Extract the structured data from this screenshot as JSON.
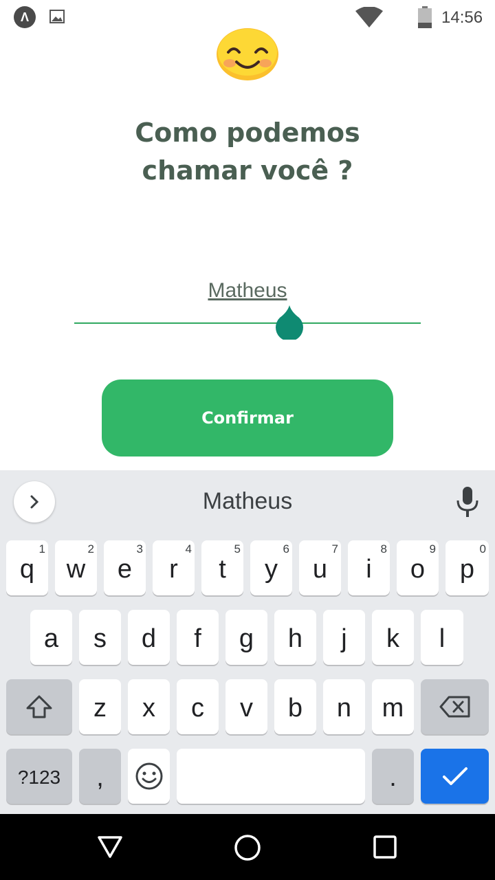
{
  "status_bar": {
    "time": "14:56",
    "app_icon_glyph": "Λ",
    "icons": [
      "app-notification-icon",
      "image-notification-icon",
      "wifi-icon",
      "battery-icon"
    ]
  },
  "screen": {
    "emoji_icon": "smiling-face-icon",
    "title": "Como podemos\n chamar você ?",
    "name_input": {
      "value": "Matheus"
    },
    "confirm_label": "Confirmar"
  },
  "keyboard": {
    "suggestion": "Matheus",
    "row1": [
      {
        "label": "q",
        "hint": "1"
      },
      {
        "label": "w",
        "hint": "2"
      },
      {
        "label": "e",
        "hint": "3"
      },
      {
        "label": "r",
        "hint": "4"
      },
      {
        "label": "t",
        "hint": "5"
      },
      {
        "label": "y",
        "hint": "6"
      },
      {
        "label": "u",
        "hint": "7"
      },
      {
        "label": "i",
        "hint": "8"
      },
      {
        "label": "o",
        "hint": "9"
      },
      {
        "label": "p",
        "hint": "0"
      }
    ],
    "row2": [
      "a",
      "s",
      "d",
      "f",
      "g",
      "h",
      "j",
      "k",
      "l"
    ],
    "row3": [
      "z",
      "x",
      "c",
      "v",
      "b",
      "n",
      "m"
    ],
    "symbols_label": "?123",
    "comma_label": ",",
    "period_label": "."
  },
  "colors": {
    "title": "#4a5f52",
    "accent_green": "#32b768",
    "input_line": "#2fa860",
    "cursor_handle": "#0f8a72",
    "enter_key": "#1a73e8"
  }
}
